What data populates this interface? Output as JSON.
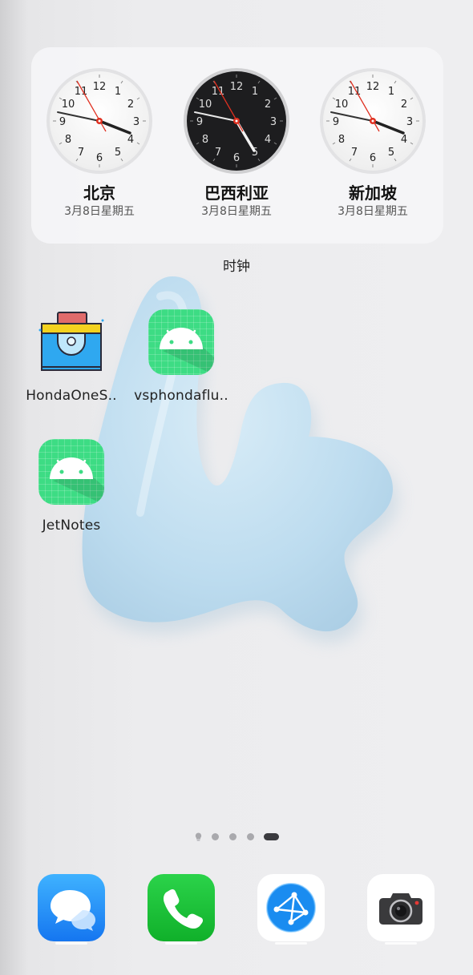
{
  "clock_widget": {
    "clocks": [
      {
        "city": "北京",
        "date": "3月8日星期五",
        "theme": "light"
      },
      {
        "city": "巴西利亚",
        "date": "3月8日星期五",
        "theme": "dark"
      },
      {
        "city": "新加坡",
        "date": "3月8日星期五",
        "theme": "light"
      }
    ],
    "label": "时钟"
  },
  "apps": [
    {
      "label": "HondaOneS..",
      "icon": "toolbox-icon"
    },
    {
      "label": "vsphondaflu..",
      "icon": "android-icon"
    },
    {
      "label": "JetNotes",
      "icon": "android-icon"
    }
  ],
  "page_indicator": {
    "pages": 5,
    "current": 5,
    "home_page_icon": "lightbulb-icon"
  },
  "dock": [
    {
      "name": "messages",
      "icon": "chat-bubbles-icon",
      "color": "#1e90ff"
    },
    {
      "name": "phone",
      "icon": "phone-icon",
      "color": "#1dc430"
    },
    {
      "name": "browser",
      "icon": "compass-network-icon",
      "color": "#1a8cf0"
    },
    {
      "name": "camera",
      "icon": "camera-icon",
      "color": "#333333"
    }
  ],
  "colors": {
    "android_green": "#3ddc84",
    "second_hand": "#e03020"
  }
}
